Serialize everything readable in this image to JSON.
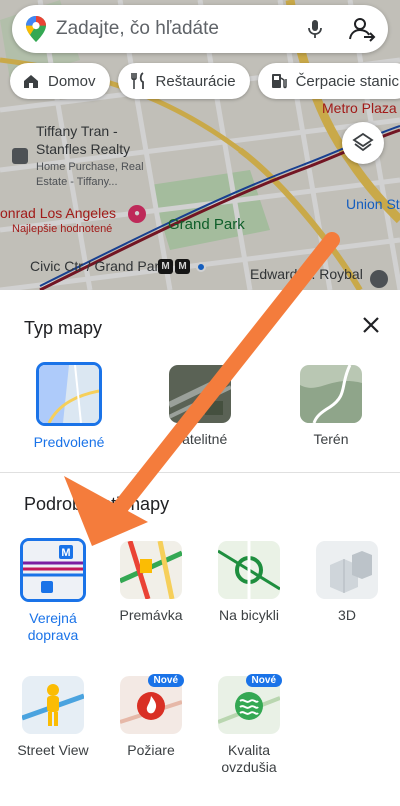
{
  "search": {
    "placeholder": "Zadajte, čo hľadáte"
  },
  "chips": [
    {
      "label": "Domov",
      "icon": "home-icon"
    },
    {
      "label": "Reštaurácie",
      "icon": "fork-knife-icon"
    },
    {
      "label": "Čerpacie stanic",
      "icon": "gas-pump-icon"
    }
  ],
  "map": {
    "labels": {
      "metro_plaza": "Metro Plaza",
      "tiffany_1": "Tiffany Tran -",
      "tiffany_2": "Stanfles Realty",
      "home_purchase": "Home Purchase, Real",
      "estate": "Estate - Tiffany...",
      "conrad": "onrad Los Angeles",
      "best_rated": "Najlepšie hodnotené",
      "grand_park": "Grand Park",
      "union": "Union St",
      "civic": "Civic Ctr / Grand Park",
      "edward": "Edward R. Roybal",
      "metro_m": "M"
    }
  },
  "sheet": {
    "map_type_title": "Typ mapy",
    "details_title": "Podrobnosti mapy",
    "new_badge": "Nové",
    "map_types": [
      {
        "label": "Predvolené",
        "selected": true
      },
      {
        "label": "Satelitné",
        "selected": false
      },
      {
        "label": "Terén",
        "selected": false
      }
    ],
    "details": [
      {
        "label": "Verejná doprava",
        "selected": true
      },
      {
        "label": "Premávka",
        "selected": false
      },
      {
        "label": "Na bicykli",
        "selected": false
      },
      {
        "label": "3D",
        "selected": false
      },
      {
        "label": "Street View",
        "selected": false
      },
      {
        "label": "Požiare",
        "selected": false,
        "new": true
      },
      {
        "label": "Kvalita ovzdušia",
        "selected": false,
        "new": true
      }
    ]
  },
  "colors": {
    "accent": "#1a73e8",
    "arrow": "#f47c3c"
  }
}
